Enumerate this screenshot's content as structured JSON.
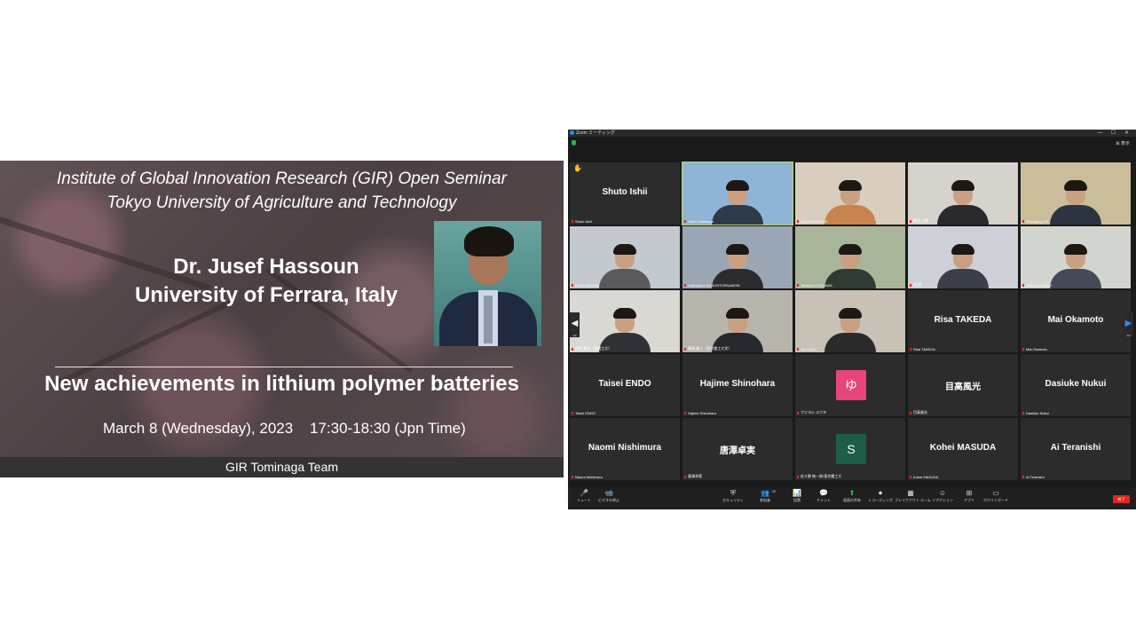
{
  "slide": {
    "title_line1": "Institute of Global Innovation Research (GIR) Open Seminar",
    "title_line2": "Tokyo University of Agriculture and Technology",
    "speaker": "Dr. Jusef Hassoun",
    "affiliation": "University of Ferrara, Italy",
    "topic": "New achievements in lithium polymer batteries",
    "date": "March 8 (Wednesday), 2023",
    "time": "17:30-18:30 (Jpn Time)",
    "footer": "GIR Tominaga Team"
  },
  "zoom": {
    "window_title": "Zoom ミーティング",
    "window_controls": "— ☐ ✕",
    "view_button": "⊞ 表示",
    "pager_left": "◀",
    "pager_left_count": "1/2",
    "pager_right": "▶",
    "pager_right_count": "1/2",
    "tiles": [
      {
        "type": "name",
        "name": "Shuto Ishii",
        "label": "Shuto Ishii",
        "hand": true
      },
      {
        "type": "video",
        "label": "Yoichi Tominaga",
        "active": true,
        "bg": "#8fb4d8",
        "shirt": "#2f3a48"
      },
      {
        "type": "video",
        "label": "Jusef HASSOUN",
        "bg": "#d9cdbf",
        "shirt": "#c9834e"
      },
      {
        "type": "video",
        "label": "篠田 大輝",
        "bg": "#d6d3cc",
        "shirt": "#2a2a2e"
      },
      {
        "type": "video",
        "label": "Zhenyang Cui",
        "bg": "#c9bd9a",
        "shirt": "#2b3440"
      },
      {
        "type": "video",
        "label": "Kento KIMURA",
        "bg": "#c4c9cf",
        "shirt": "#5a5a5c"
      },
      {
        "type": "video",
        "label": "Natthaphol NGAONTORNAMON",
        "bg": "#9aa6b4",
        "shirt": "#2c2c30"
      },
      {
        "type": "video",
        "label": "Takahiro ICHIKAWA",
        "bg": "#a9b59a",
        "shirt": "#303a34"
      },
      {
        "type": "video",
        "label": "渡 瑞",
        "bg": "#cdd0d6",
        "shirt": "#3b3f4a"
      },
      {
        "type": "video",
        "label": "Hideyuki Omichi",
        "bg": "#d2d4d0",
        "shirt": "#444a58"
      },
      {
        "type": "video",
        "label": "中野 春花（東農工大）",
        "bg": "#dad8d2",
        "shirt": "#2f3136"
      },
      {
        "type": "video",
        "label": "藤橋 義二（東京農工大学）",
        "bg": "#b7b4ac",
        "shirt": "#26282e"
      },
      {
        "type": "video",
        "label": "Ya-Ci Kim",
        "bg": "#c8c2b6",
        "shirt": "#2a2a2a"
      },
      {
        "type": "name",
        "name": "Risa TAKEDA",
        "label": "Risa TAKEDA"
      },
      {
        "type": "name",
        "name": "Mai Okamoto",
        "label": "Mai Okamoto"
      },
      {
        "type": "name",
        "name": "Taisei ENDO",
        "label": "Taisei ENDO"
      },
      {
        "type": "name",
        "name": "Hajime Shinohara",
        "label": "Hajime Shinohara"
      },
      {
        "type": "avatar",
        "avatar": "ゆ",
        "color": "#e8457a",
        "label": "フジヨシ ユウタ"
      },
      {
        "type": "name",
        "name": "目高風光",
        "label": "目高風光"
      },
      {
        "type": "name",
        "name": "Dasiuke Nukui",
        "label": "Dasiuke Nukui"
      },
      {
        "type": "name",
        "name": "Naomi Nishimura",
        "label": "Naomi Nishimura"
      },
      {
        "type": "name",
        "name": "唐澤卓実",
        "label": "唐澤卓実"
      },
      {
        "type": "avatar",
        "avatar": "S",
        "color": "#1e5e47",
        "label": "佐々野 純一郎/東京農工大"
      },
      {
        "type": "name",
        "name": "Kohei MASUDA",
        "label": "Kohei MASUDA"
      },
      {
        "type": "name",
        "name": "Ai Teranishi",
        "label": "Ai Teranishi"
      }
    ],
    "toolbar": [
      {
        "icon": "🎤",
        "label": "ミュート",
        "name": "mute-button"
      },
      {
        "icon": "📹",
        "label": "ビデオの停止",
        "name": "stop-video-button"
      },
      {
        "icon": "⛨",
        "label": "セキュリティ",
        "name": "security-button"
      },
      {
        "icon": "👥",
        "label": "参加者",
        "name": "participants-button"
      },
      {
        "icon": "📊",
        "label": "投票",
        "name": "polls-button"
      },
      {
        "icon": "💬",
        "label": "チャット",
        "name": "chat-button"
      },
      {
        "icon": "⬆",
        "label": "画面の共有",
        "name": "share-screen-button"
      },
      {
        "icon": "⏺",
        "label": "レコーディング",
        "name": "record-button"
      },
      {
        "icon": "▦",
        "label": "ブレイクアウト ルーム",
        "name": "breakout-rooms-button"
      },
      {
        "icon": "☺",
        "label": "リアクション",
        "name": "reactions-button"
      },
      {
        "icon": "⊞",
        "label": "アプリ",
        "name": "apps-button"
      },
      {
        "icon": "▭",
        "label": "ホワイトボード",
        "name": "whiteboard-button"
      }
    ],
    "participants_count": "25",
    "leave_label": "終了"
  }
}
